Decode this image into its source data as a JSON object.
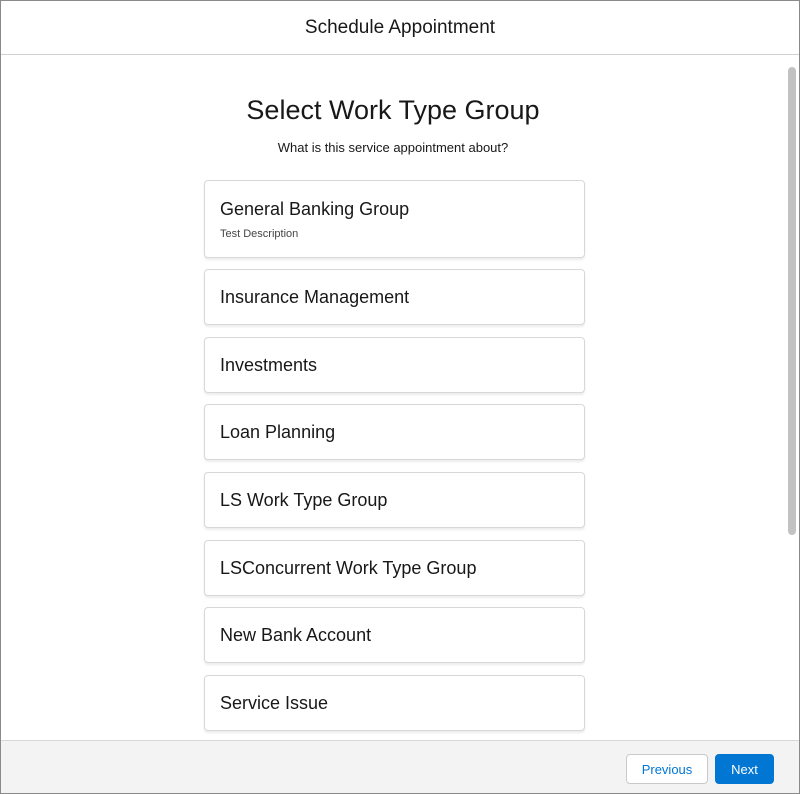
{
  "header": {
    "title": "Schedule Appointment"
  },
  "main": {
    "title": "Select Work Type Group",
    "subtitle": "What is this service appointment about?",
    "groups": [
      {
        "name": "General Banking Group",
        "description": "Test Description"
      },
      {
        "name": "Insurance Management"
      },
      {
        "name": "Investments"
      },
      {
        "name": "Loan Planning"
      },
      {
        "name": "LS Work Type Group"
      },
      {
        "name": "LSConcurrent Work Type Group"
      },
      {
        "name": "New Bank Account"
      },
      {
        "name": "Service Issue"
      }
    ]
  },
  "footer": {
    "previous_label": "Previous",
    "next_label": "Next"
  },
  "colors": {
    "brand": "#0176d3",
    "footer_bg": "#f3f3f3"
  }
}
